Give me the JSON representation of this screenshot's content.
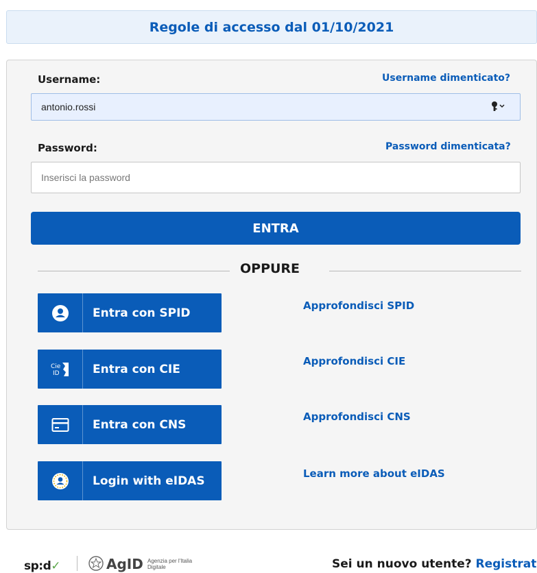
{
  "banner": {
    "text": "Regole di accesso dal 01/10/2021"
  },
  "login": {
    "username_label": "Username:",
    "forgot_username": "Username dimenticato?",
    "username_value": "antonio.rossi",
    "password_label": "Password:",
    "forgot_password": "Password dimenticata?",
    "password_placeholder": "Inserisci la password",
    "submit_label": "ENTRA",
    "or_label": "OPPURE"
  },
  "identity": [
    {
      "label": "Entra con SPID",
      "icon": "user-icon",
      "learn": "Approfondisci SPID"
    },
    {
      "label": "Entra con CIE",
      "icon": "cie-card-icon",
      "learn": "Approfondisci CIE"
    },
    {
      "label": "Entra con CNS",
      "icon": "credit-card-icon",
      "learn": "Approfondisci CNS"
    },
    {
      "label": "Login with eIDAS",
      "icon": "eidas-icon",
      "learn": "Learn more about eIDAS"
    }
  ],
  "footer": {
    "spid_logo": "sp:d",
    "agid_logo": "AgID",
    "agid_subtitle": "Agenzia per l'Italia Digitale",
    "new_user_text": "Sei un nuovo utente? ",
    "register_link": "Registrati"
  },
  "colors": {
    "primary": "#0a5cb8",
    "banner_bg": "#eaf2fb",
    "card_bg": "#f5f5f5",
    "spid_green": "#5ba64a"
  }
}
